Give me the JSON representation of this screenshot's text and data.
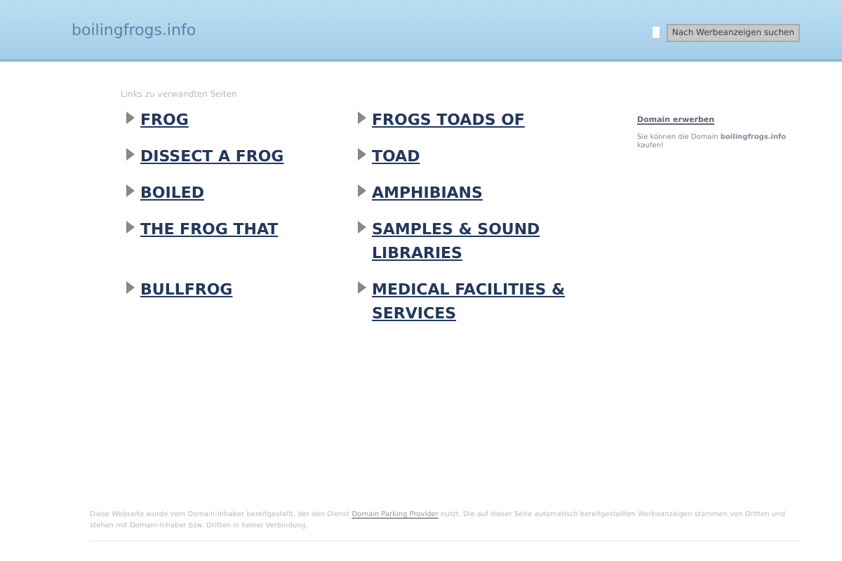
{
  "header": {
    "domain": "boilingfrogs.info",
    "search_button": "Nach Werbeanzeigen suchen"
  },
  "links_heading": "Links zu verwandten Seiten",
  "links": [
    {
      "label": "FROG"
    },
    {
      "label": "FROGS TOADS OF"
    },
    {
      "label": "DISSECT A FROG"
    },
    {
      "label": "TOAD"
    },
    {
      "label": "BOILED"
    },
    {
      "label": "AMPHIBIANS"
    },
    {
      "label": "THE FROG THAT"
    },
    {
      "label": "SAMPLES & SOUND LIBRARIES"
    },
    {
      "label": "BULLFROG"
    },
    {
      "label": "MEDICAL FACILITIES & SERVICES"
    }
  ],
  "sidebar": {
    "link": "Domain erwerben",
    "text": "Sie können die Domain **boilingfrogs.info** kaufen!"
  },
  "footer": {
    "before": "Diese Webseite wurde vom Domain-Inhaber bereitgestellt, der den Dienst",
    "link": "Domain Parking Provider",
    "after": "nutzt. Die auf dieser Seite automatisch bereitgestellten Werbeanzeigen stammen von Dritten und stehen mit Domain-Inhaber bzw. Dritten in keiner Verbindung."
  }
}
